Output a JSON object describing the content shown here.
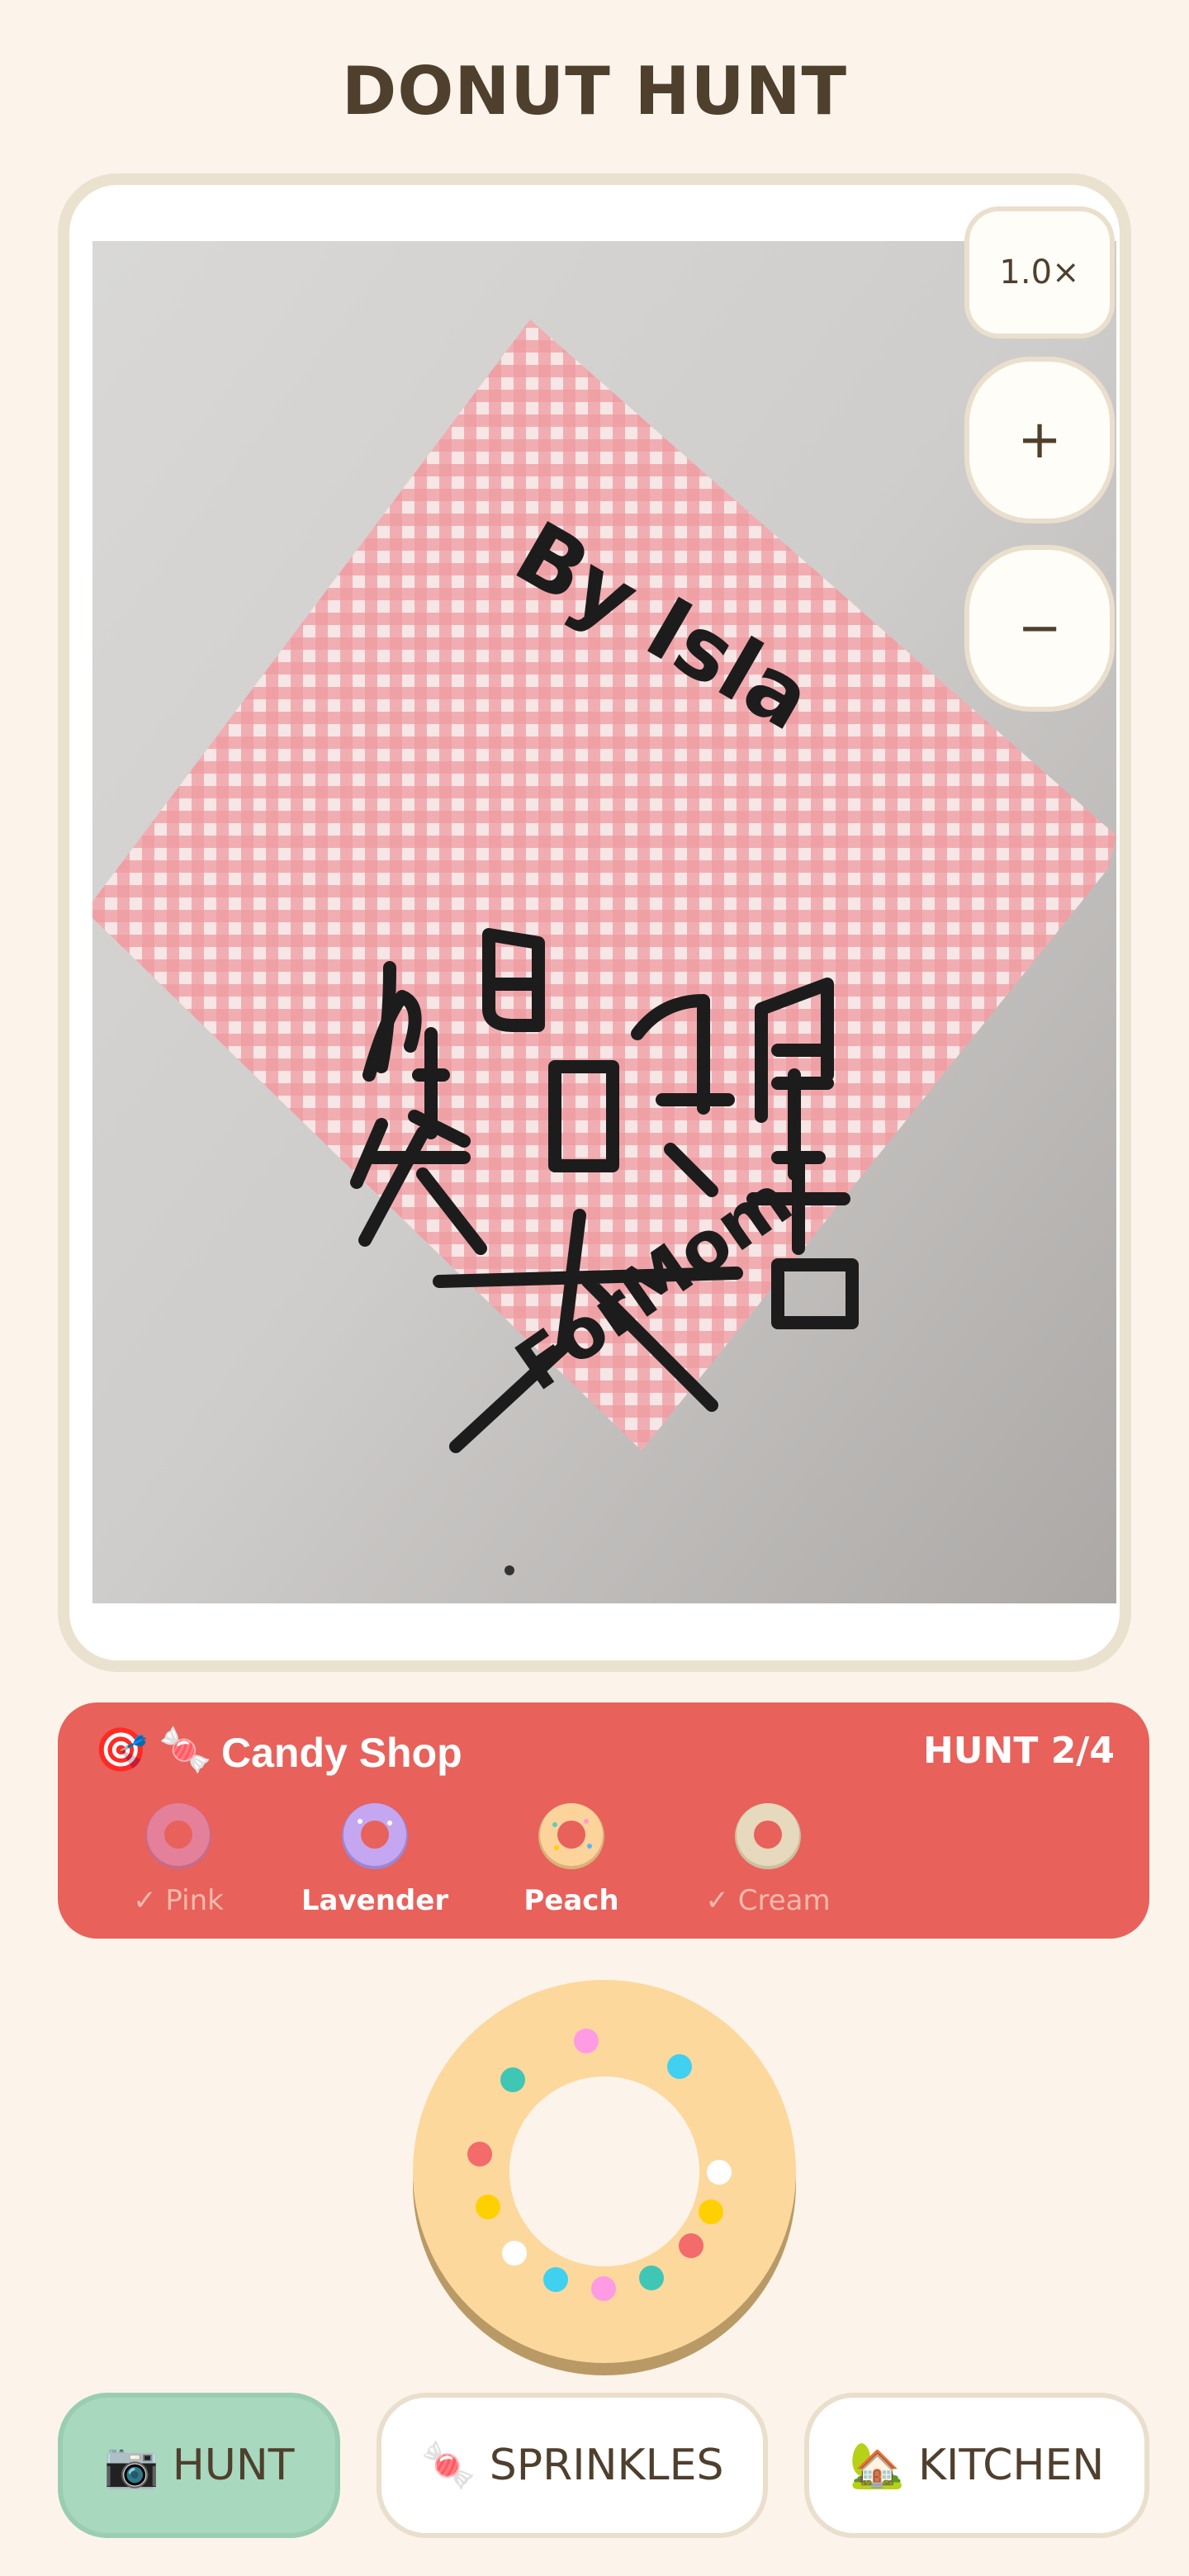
{
  "app": {
    "title": "DONUT HUNT"
  },
  "camera": {
    "zoom_level": "1.0×",
    "zoom_in": "+",
    "zoom_out": "−"
  },
  "note": {
    "line_top": "By Isla",
    "line_bottom": "ForMom"
  },
  "hunt": {
    "shop_icon_a": "target-icon",
    "shop_icon_b": "candy-icon",
    "shop_name": "Candy Shop",
    "progress": "HUNT 2/4",
    "targets": [
      {
        "label": "✓ Pink",
        "found": true,
        "color": "#f08aa3"
      },
      {
        "label": "Lavender",
        "found": false,
        "color": "#c4a7f0"
      },
      {
        "label": "Peach",
        "found": false,
        "color": "#fcd39b"
      },
      {
        "label": "✓ Cream",
        "found": true,
        "color": "#ece0c4"
      }
    ]
  },
  "donut": {
    "frosting_color": "#fdd89d",
    "base_color": "#b99a66"
  },
  "nav": [
    {
      "label": "HUNT",
      "icon": "camera-icon"
    },
    {
      "label": "SPRINKLES",
      "icon": "candy-icon"
    },
    {
      "label": "KITCHEN",
      "icon": "house-icon"
    }
  ],
  "colors": {
    "background": "#fcf4ea",
    "accent": "#e8615b",
    "active_nav": "#a8d8bd",
    "text": "#4f3f2d"
  }
}
